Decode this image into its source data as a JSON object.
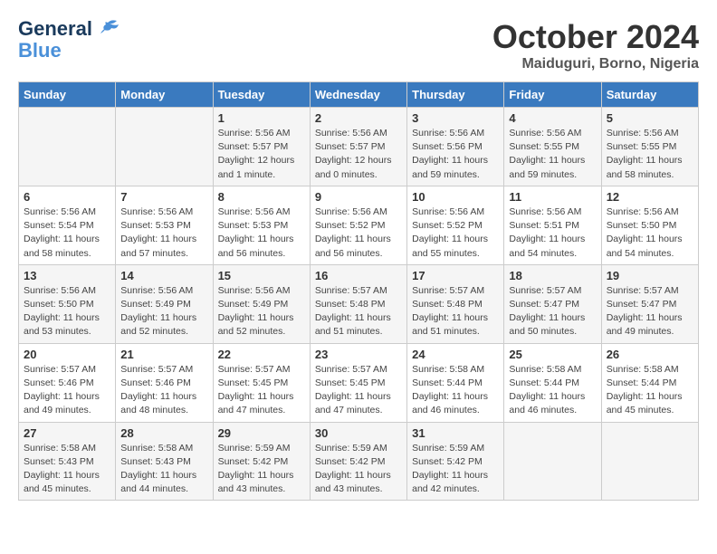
{
  "logo": {
    "line1": "General",
    "line2": "Blue"
  },
  "title": "October 2024",
  "location": "Maiduguri, Borno, Nigeria",
  "days_of_week": [
    "Sunday",
    "Monday",
    "Tuesday",
    "Wednesday",
    "Thursday",
    "Friday",
    "Saturday"
  ],
  "weeks": [
    [
      {
        "day": "",
        "detail": ""
      },
      {
        "day": "",
        "detail": ""
      },
      {
        "day": "1",
        "detail": "Sunrise: 5:56 AM\nSunset: 5:57 PM\nDaylight: 12 hours\nand 1 minute."
      },
      {
        "day": "2",
        "detail": "Sunrise: 5:56 AM\nSunset: 5:57 PM\nDaylight: 12 hours\nand 0 minutes."
      },
      {
        "day": "3",
        "detail": "Sunrise: 5:56 AM\nSunset: 5:56 PM\nDaylight: 11 hours\nand 59 minutes."
      },
      {
        "day": "4",
        "detail": "Sunrise: 5:56 AM\nSunset: 5:55 PM\nDaylight: 11 hours\nand 59 minutes."
      },
      {
        "day": "5",
        "detail": "Sunrise: 5:56 AM\nSunset: 5:55 PM\nDaylight: 11 hours\nand 58 minutes."
      }
    ],
    [
      {
        "day": "6",
        "detail": "Sunrise: 5:56 AM\nSunset: 5:54 PM\nDaylight: 11 hours\nand 58 minutes."
      },
      {
        "day": "7",
        "detail": "Sunrise: 5:56 AM\nSunset: 5:53 PM\nDaylight: 11 hours\nand 57 minutes."
      },
      {
        "day": "8",
        "detail": "Sunrise: 5:56 AM\nSunset: 5:53 PM\nDaylight: 11 hours\nand 56 minutes."
      },
      {
        "day": "9",
        "detail": "Sunrise: 5:56 AM\nSunset: 5:52 PM\nDaylight: 11 hours\nand 56 minutes."
      },
      {
        "day": "10",
        "detail": "Sunrise: 5:56 AM\nSunset: 5:52 PM\nDaylight: 11 hours\nand 55 minutes."
      },
      {
        "day": "11",
        "detail": "Sunrise: 5:56 AM\nSunset: 5:51 PM\nDaylight: 11 hours\nand 54 minutes."
      },
      {
        "day": "12",
        "detail": "Sunrise: 5:56 AM\nSunset: 5:50 PM\nDaylight: 11 hours\nand 54 minutes."
      }
    ],
    [
      {
        "day": "13",
        "detail": "Sunrise: 5:56 AM\nSunset: 5:50 PM\nDaylight: 11 hours\nand 53 minutes."
      },
      {
        "day": "14",
        "detail": "Sunrise: 5:56 AM\nSunset: 5:49 PM\nDaylight: 11 hours\nand 52 minutes."
      },
      {
        "day": "15",
        "detail": "Sunrise: 5:56 AM\nSunset: 5:49 PM\nDaylight: 11 hours\nand 52 minutes."
      },
      {
        "day": "16",
        "detail": "Sunrise: 5:57 AM\nSunset: 5:48 PM\nDaylight: 11 hours\nand 51 minutes."
      },
      {
        "day": "17",
        "detail": "Sunrise: 5:57 AM\nSunset: 5:48 PM\nDaylight: 11 hours\nand 51 minutes."
      },
      {
        "day": "18",
        "detail": "Sunrise: 5:57 AM\nSunset: 5:47 PM\nDaylight: 11 hours\nand 50 minutes."
      },
      {
        "day": "19",
        "detail": "Sunrise: 5:57 AM\nSunset: 5:47 PM\nDaylight: 11 hours\nand 49 minutes."
      }
    ],
    [
      {
        "day": "20",
        "detail": "Sunrise: 5:57 AM\nSunset: 5:46 PM\nDaylight: 11 hours\nand 49 minutes."
      },
      {
        "day": "21",
        "detail": "Sunrise: 5:57 AM\nSunset: 5:46 PM\nDaylight: 11 hours\nand 48 minutes."
      },
      {
        "day": "22",
        "detail": "Sunrise: 5:57 AM\nSunset: 5:45 PM\nDaylight: 11 hours\nand 47 minutes."
      },
      {
        "day": "23",
        "detail": "Sunrise: 5:57 AM\nSunset: 5:45 PM\nDaylight: 11 hours\nand 47 minutes."
      },
      {
        "day": "24",
        "detail": "Sunrise: 5:58 AM\nSunset: 5:44 PM\nDaylight: 11 hours\nand 46 minutes."
      },
      {
        "day": "25",
        "detail": "Sunrise: 5:58 AM\nSunset: 5:44 PM\nDaylight: 11 hours\nand 46 minutes."
      },
      {
        "day": "26",
        "detail": "Sunrise: 5:58 AM\nSunset: 5:44 PM\nDaylight: 11 hours\nand 45 minutes."
      }
    ],
    [
      {
        "day": "27",
        "detail": "Sunrise: 5:58 AM\nSunset: 5:43 PM\nDaylight: 11 hours\nand 45 minutes."
      },
      {
        "day": "28",
        "detail": "Sunrise: 5:58 AM\nSunset: 5:43 PM\nDaylight: 11 hours\nand 44 minutes."
      },
      {
        "day": "29",
        "detail": "Sunrise: 5:59 AM\nSunset: 5:42 PM\nDaylight: 11 hours\nand 43 minutes."
      },
      {
        "day": "30",
        "detail": "Sunrise: 5:59 AM\nSunset: 5:42 PM\nDaylight: 11 hours\nand 43 minutes."
      },
      {
        "day": "31",
        "detail": "Sunrise: 5:59 AM\nSunset: 5:42 PM\nDaylight: 11 hours\nand 42 minutes."
      },
      {
        "day": "",
        "detail": ""
      },
      {
        "day": "",
        "detail": ""
      }
    ]
  ]
}
